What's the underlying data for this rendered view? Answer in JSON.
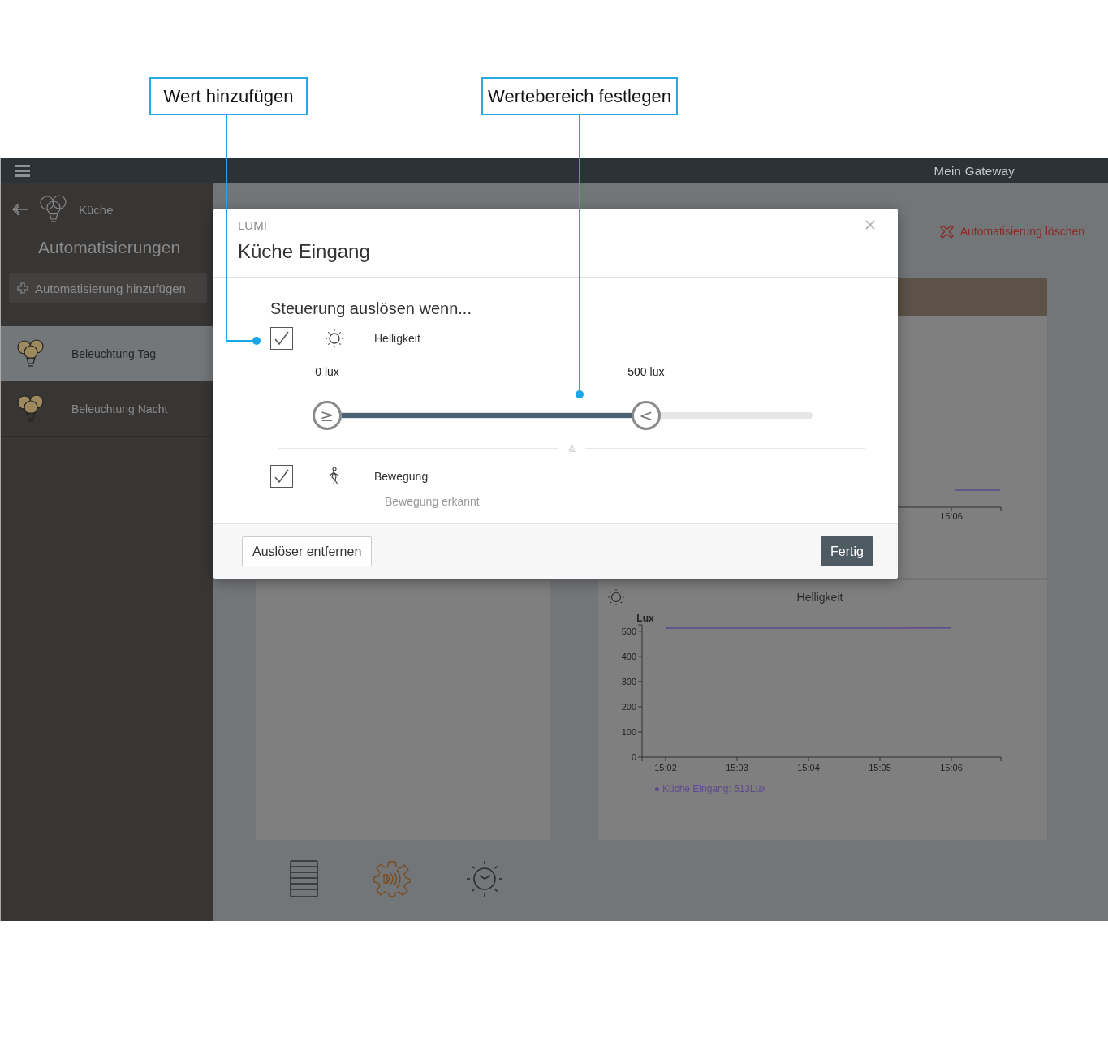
{
  "callouts": [
    {
      "label": "Wert hinzufügen"
    },
    {
      "label": "Wertebereich festlegen"
    }
  ],
  "top_bar": {
    "title": "Mein Gateway"
  },
  "sidebar": {
    "room": "Küche",
    "heading": "Automatisierungen",
    "add_button": "Automatisierung hinzufügen",
    "items": [
      {
        "label": "Beleuchtung Tag",
        "selected": true
      },
      {
        "label": "Beleuchtung Nacht",
        "selected": false
      }
    ]
  },
  "main": {
    "delete_link": "Automatisierung löschen",
    "partial_chart": {
      "tick_label": "15:06"
    },
    "chart": {
      "legend_suffix": ": 513Lux",
      "chart_data": {
        "type": "line",
        "title": "Helligkeit",
        "ylabel": "Lux",
        "categories": [
          "15:02",
          "15:03",
          "15:04",
          "15:05",
          "15:06"
        ],
        "series": [
          {
            "name": "Küche Eingang",
            "color": "#5e4a8e",
            "values": [
              512,
              512,
              512,
              512,
              513
            ]
          }
        ],
        "ylim": [
          0,
          525
        ],
        "yticks": [
          0,
          100,
          200,
          300,
          400,
          500
        ]
      }
    }
  },
  "dialog": {
    "brand": "LUMI",
    "title": "Küche Eingang",
    "prompt": "Steuerung auslösen wenn...",
    "joiner": "&",
    "triggers": [
      {
        "kind": "brightness",
        "checked": true,
        "label": "Helligkeit",
        "slider": {
          "handles": [
            {
              "symbol": "≥",
              "label": "0 lux",
              "level": 0
            },
            {
              "symbol": "<",
              "label": "500 lux",
              "level": 0.657
            }
          ]
        }
      },
      {
        "kind": "motion",
        "checked": true,
        "label": "Bewegung",
        "detail": "Bewegung erkannt"
      }
    ],
    "remove_button": "Auslöser entfernen",
    "done_button": "Fertig"
  }
}
